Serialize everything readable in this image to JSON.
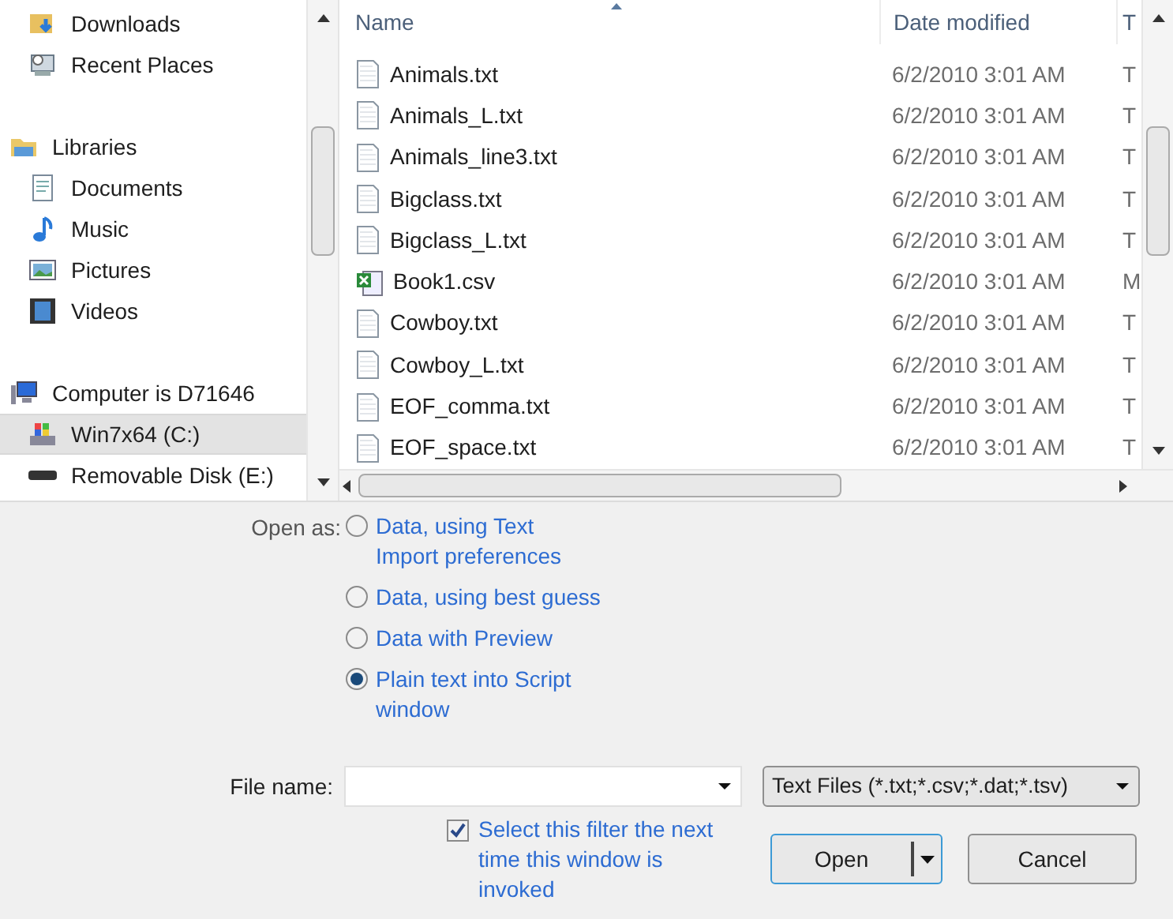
{
  "navigation": [
    {
      "items": [
        {
          "label": "Downloads",
          "kind": "downloads",
          "selected": false
        },
        {
          "label": "Recent Places",
          "kind": "recent",
          "selected": false
        }
      ]
    },
    {
      "label": "Libraries",
      "kind": "library",
      "selected": false,
      "children": [
        {
          "label": "Documents",
          "kind": "documents",
          "selected": false
        },
        {
          "label": "Music",
          "kind": "music",
          "selected": false
        },
        {
          "label": "Pictures",
          "kind": "pictures",
          "selected": false
        },
        {
          "label": "Videos",
          "kind": "videos",
          "selected": false
        }
      ]
    },
    {
      "label": "Computer is D71646",
      "kind": "computer",
      "selected": false,
      "children": [
        {
          "label": "Win7x64 (C:)",
          "kind": "drive",
          "selected": true
        },
        {
          "label": "Removable Disk (E:)",
          "kind": "removable",
          "selected": false
        }
      ]
    }
  ],
  "file_list": {
    "columns": [
      "Name",
      "Date modified",
      "T"
    ],
    "rows": [
      {
        "name": "Animals.txt",
        "kind": "text",
        "date": "6/2/2010 3:01 AM",
        "column_3": "T"
      },
      {
        "name": "Animals_L.txt",
        "kind": "text",
        "date": "6/2/2010 3:01 AM",
        "column_3": "T"
      },
      {
        "name": "Animals_line3.txt",
        "kind": "text",
        "date": "6/2/2010 3:01 AM",
        "column_3": "T"
      },
      {
        "name": "Bigclass.txt",
        "kind": "text",
        "date": "6/2/2010 3:01 AM",
        "column_3": "T"
      },
      {
        "name": "Bigclass_L.txt",
        "kind": "text",
        "date": "6/2/2010 3:01 AM",
        "column_3": "T"
      },
      {
        "name": "Book1.csv",
        "kind": "spreadsheet",
        "date": "6/2/2010 3:01 AM",
        "column_3": "M"
      },
      {
        "name": "Cowboy.txt",
        "kind": "text",
        "date": "6/2/2010 3:01 AM",
        "column_3": "T"
      },
      {
        "name": "Cowboy_L.txt",
        "kind": "text",
        "date": "6/2/2010 3:01 AM",
        "column_3": "T"
      },
      {
        "name": "EOF_comma.txt",
        "kind": "text",
        "date": "6/2/2010 3:01 AM",
        "column_3": "T"
      },
      {
        "name": "EOF_space.txt",
        "kind": "text",
        "date": "6/2/2010 3:01 AM",
        "column_3": "T"
      }
    ]
  },
  "open_as": {
    "label": "Open as:",
    "options": [
      {
        "label": "Data, using Text\nImport preferences",
        "selected": false
      },
      {
        "label": "Data, using best guess",
        "selected": false
      },
      {
        "label": "Data with Preview",
        "selected": false
      },
      {
        "label": "Plain text into Script\nwindow",
        "selected": true
      }
    ]
  },
  "file_name": {
    "label": "File name:"
  },
  "file_type": {
    "value": "Text Files (*.txt;*.csv;*.dat;*.tsv)"
  },
  "remember_filter": {
    "label": "Select this filter the next\ntime this window is\ninvoked",
    "checked": true
  },
  "buttons": {
    "open": "Open",
    "cancel": "Cancel"
  }
}
